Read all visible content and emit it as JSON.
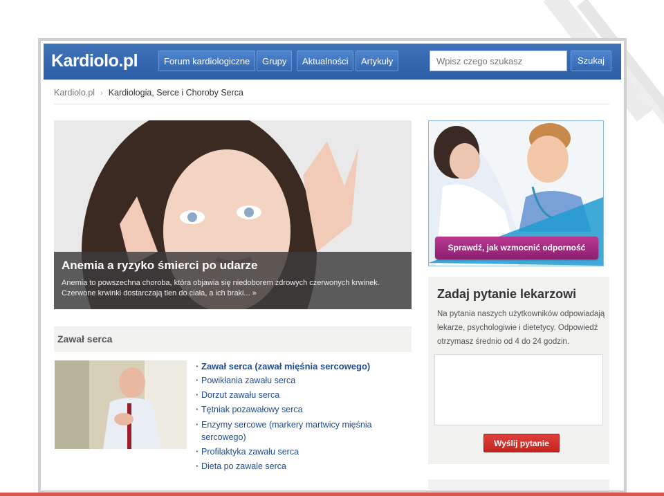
{
  "header": {
    "logo": "Kardiolo.pl",
    "nav": [
      "Forum kardiologiczne",
      "Grupy",
      "Aktualności",
      "Artykuły"
    ],
    "search_placeholder": "Wpisz czego szukasz",
    "search_button": "Szukaj",
    "brand_color": "#2f62aa"
  },
  "breadcrumb": {
    "home": "Kardiolo.pl",
    "separator": "›",
    "current": "Kardiologia, Serce i Choroby Serca"
  },
  "hero": {
    "title": "Anemia a ryzyko śmierci po udarze",
    "text": "Anemia to powszechna choroba, która objawia się niedoborem zdrowych czerwonych krwinek. Czerwone krwinki dostarczają tlen do ciała, a ich braki... »"
  },
  "section": {
    "title": "Zawał serca",
    "links": [
      "Zawał serca (zawał mięśnia sercowego)",
      "Powikłania zawału serca",
      "Dorzut zawału serca",
      "Tętniak pozawałowy serca",
      "Enzymy sercowe (markery martwicy mięśnia sercowego)",
      "Profilaktyka zawału serca",
      "Dieta po zawale serca"
    ]
  },
  "ad": {
    "banner": "Sprawdź, jak wzmocnić odporność dziecka!"
  },
  "ask": {
    "title": "Zadaj pytanie lekarzowi",
    "text": "Na pytania naszych użytkowników odpowiadają lekarze, psychologiwie i dietetycy. Odpowiedź otrzymasz średnio od 4 do 24 godzin.",
    "button": "Wyślij pytanie"
  }
}
